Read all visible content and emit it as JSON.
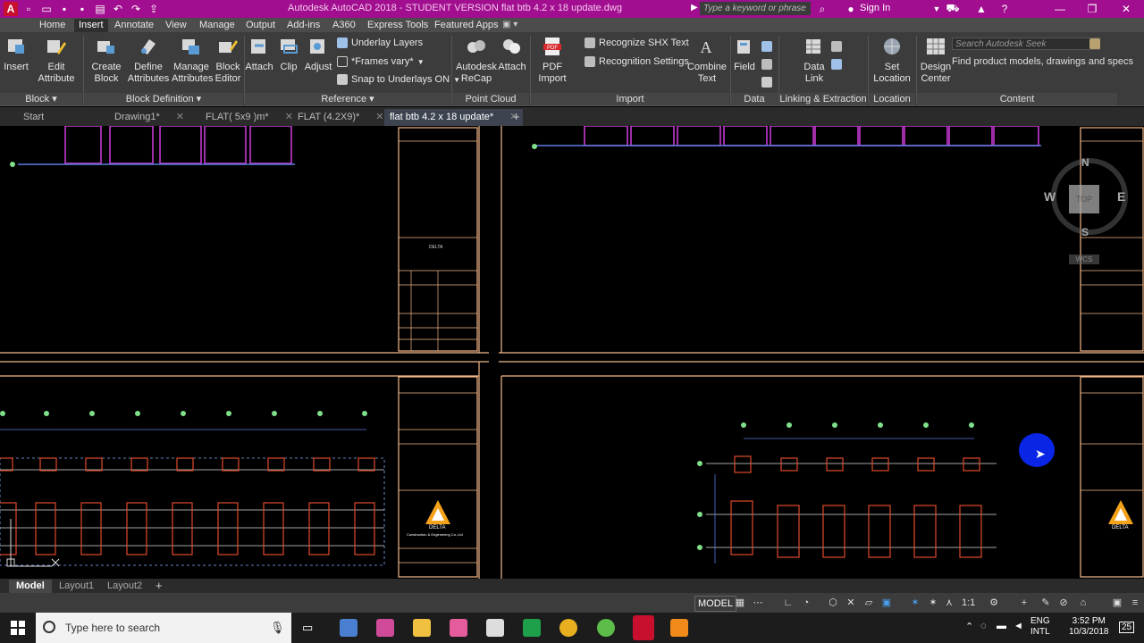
{
  "window": {
    "title": "Autodesk AutoCAD 2018 - STUDENT VERSION    flat btb 4.2 x 18 update.dwg",
    "search_placeholder": "Type a keyword or phrase",
    "sign_in": "Sign In"
  },
  "ribbon_tabs": [
    "Home",
    "Insert",
    "Annotate",
    "View",
    "Manage",
    "Output",
    "Add-ins",
    "A360",
    "Express Tools",
    "Featured Apps"
  ],
  "active_tab": "Insert",
  "ribbon": {
    "block": {
      "insert": "Insert",
      "edit_attribute": "Edit Attribute",
      "label": "Block"
    },
    "block_definition": {
      "create_block": "Create Block",
      "define_attributes": "Define Attributes",
      "manage_attributes": "Manage Attributes",
      "block_editor": "Block Editor",
      "label": "Block Definition"
    },
    "reference": {
      "attach": "Attach",
      "clip": "Clip",
      "adjust": "Adjust",
      "underlay_layers": "Underlay Layers",
      "frames_vary": "*Frames vary*",
      "snap_to_underlays": "Snap to Underlays ON",
      "label": "Reference"
    },
    "point_cloud": {
      "autodesk_recap": "Autodesk ReCap",
      "attach": "Attach",
      "label": "Point Cloud"
    },
    "import": {
      "pdf_import": "PDF Import",
      "recognize_shx": "Recognize SHX Text",
      "recognition_settings": "Recognition Settings",
      "combine_text": "Combine Text",
      "label": "Import"
    },
    "data": {
      "field": "Field",
      "label": "Data"
    },
    "linking": {
      "data_link": "Data Link",
      "label": "Linking & Extraction"
    },
    "location": {
      "set_location": "Set Location",
      "label": "Location"
    },
    "content": {
      "design_center": "Design Center",
      "seek_placeholder": "Search Autodesk Seek",
      "find_text": "Find product models, drawings and specs",
      "label": "Content"
    }
  },
  "doc_tabs": [
    "Start",
    "Drawing1*",
    "FLAT( 5x9 )m*",
    "FLAT (4.2X9)*",
    "flat btb 4.2 x 18 update*"
  ],
  "active_doc_tab": "flat btb 4.2 x 18 update*",
  "viewcube": {
    "n": "N",
    "s": "S",
    "e": "E",
    "w": "W",
    "top": "TOP",
    "wcs": "WCS"
  },
  "drawing": {
    "company": "DELTA",
    "company_sub": "Construction & Engineering Co.,Ltd"
  },
  "layout_tabs": [
    "Model",
    "Layout1",
    "Layout2"
  ],
  "active_layout": "Model",
  "status": {
    "model": "MODEL",
    "scale": "1:1"
  },
  "taskbar": {
    "search_placeholder": "Type here to search",
    "lang1": "ENG",
    "lang2": "INTL",
    "time": "3:52 PM",
    "date": "10/3/2018",
    "notifications": "25"
  },
  "colors": {
    "title_bar": "#a10e8f",
    "ribbon": "#3c3c3c",
    "frame": "#f2b88a",
    "magenta": "#d23ce0",
    "cursor": "#0a25e6"
  }
}
